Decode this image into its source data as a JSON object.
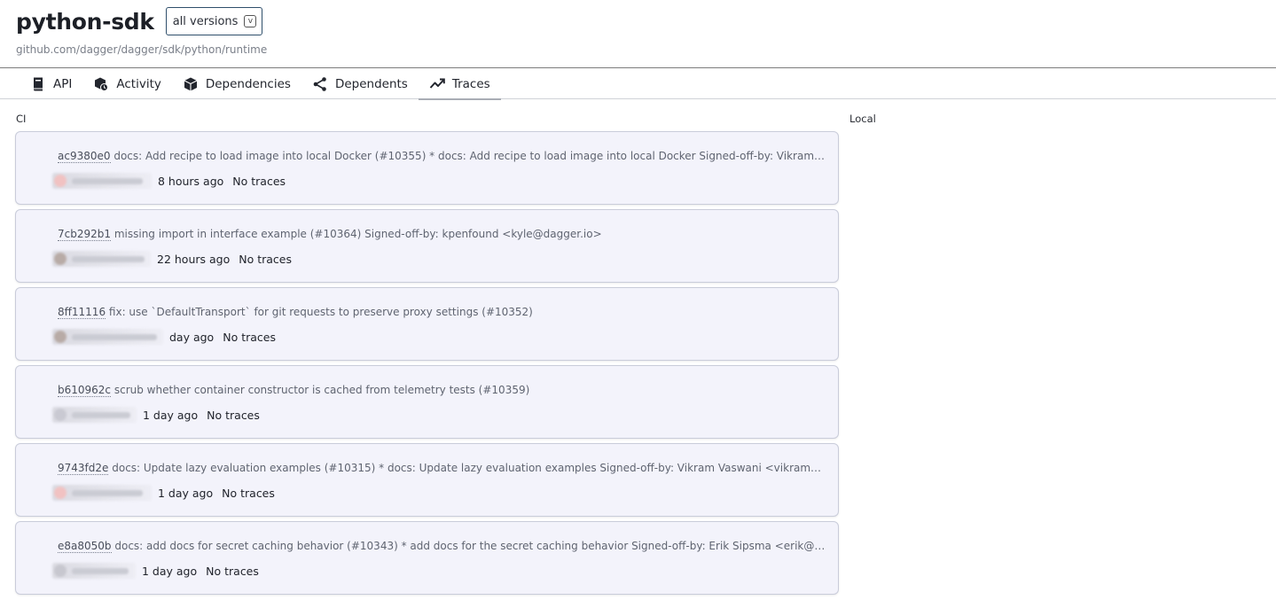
{
  "header": {
    "title": "python-sdk",
    "version_select": "all versions",
    "version_chevron": "v",
    "subtitle": "github.com/dagger/dagger/sdk/python/runtime"
  },
  "tabs": [
    {
      "label": "API",
      "icon": "book-icon"
    },
    {
      "label": "Activity",
      "icon": "activity-box-icon"
    },
    {
      "label": "Dependencies",
      "icon": "package-icon"
    },
    {
      "label": "Dependents",
      "icon": "share-icon"
    },
    {
      "label": "Traces",
      "icon": "trend-icon",
      "active": true
    }
  ],
  "columns": {
    "ci": "CI",
    "local": "Local"
  },
  "commits": [
    {
      "sha": "ac9380e0",
      "message": "docs: Add recipe to load image into local Docker (#10355) * docs: Add recipe to load image into local Docker Signed-off-by: Vikram Vaswani <vikram@dagger.io>",
      "time": "8 hours ago",
      "traces": "No traces"
    },
    {
      "sha": "7cb292b1",
      "message": "missing import in interface example (#10364) Signed-off-by: kpenfound <kyle@dagger.io>",
      "time": "22 hours ago",
      "traces": "No traces"
    },
    {
      "sha": "8ff11116",
      "message": "fix: use `DefaultTransport` for git requests to preserve proxy settings (#10352)",
      "time": "day ago",
      "traces": "No traces"
    },
    {
      "sha": "b610962c",
      "message": "scrub whether container constructor is cached from telemetry tests (#10359)",
      "time": "1 day ago",
      "traces": "No traces"
    },
    {
      "sha": "9743fd2e",
      "message": "docs: Update lazy evaluation examples (#10315) * docs: Update lazy evaluation examples Signed-off-by: Vikram Vaswani <vikram@dagger.io>",
      "time": "1 day ago",
      "traces": "No traces"
    },
    {
      "sha": "e8a8050b",
      "message": "docs: add docs for secret caching behavior (#10343) * add docs for the secret caching behavior Signed-off-by: Erik Sipsma <erik@sipsma.dev>",
      "time": "1 day ago",
      "traces": "No traces"
    }
  ]
}
